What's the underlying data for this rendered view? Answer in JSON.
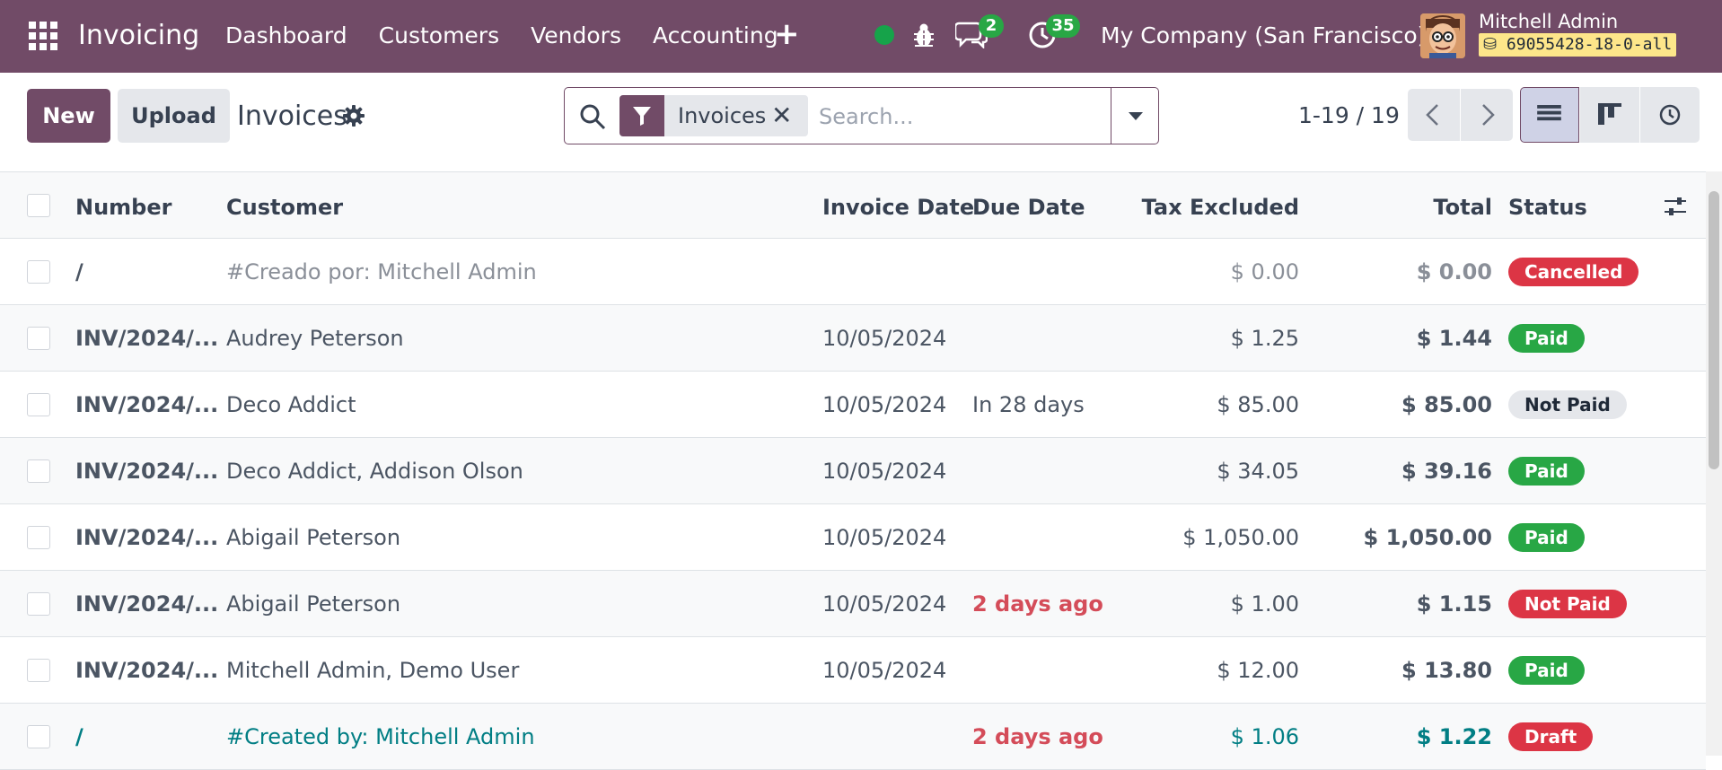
{
  "navbar": {
    "brand": "Invoicing",
    "menu": [
      {
        "label": "Dashboard"
      },
      {
        "label": "Customers"
      },
      {
        "label": "Vendors"
      },
      {
        "label": "Accounting"
      }
    ],
    "messages_count": "2",
    "activities_count": "35",
    "company": "My Company (San Francisco)",
    "user_name": "Mitchell Admin",
    "database": "69055428-18-0-all"
  },
  "control": {
    "new_label": "New",
    "upload_label": "Upload",
    "title": "Invoices",
    "facet_label": "Invoices",
    "facet_close": "✕",
    "search_placeholder": "Search...",
    "pager": "1-19 / 19"
  },
  "columns": {
    "number": "Number",
    "customer": "Customer",
    "invoice_date": "Invoice Date",
    "due_date": "Due Date",
    "tax_excluded": "Tax Excluded",
    "total": "Total",
    "status": "Status"
  },
  "rows": [
    {
      "number": "/",
      "customer": "#Creado por: Mitchell Admin",
      "invoice_date": "",
      "due_date": "",
      "tax_excluded": "$ 0.00",
      "total": "$ 0.00",
      "status": "Cancelled",
      "status_color": "#dc3545"
    },
    {
      "number": "INV/2024/...",
      "customer": "Audrey Peterson",
      "invoice_date": "10/05/2024",
      "due_date": "",
      "tax_excluded": "$ 1.25",
      "total": "$ 1.44",
      "status": "Paid",
      "status_color": "#28a745"
    },
    {
      "number": "INV/2024/...",
      "customer": "Deco Addict",
      "invoice_date": "10/05/2024",
      "due_date": "In 28 days",
      "tax_excluded": "$ 85.00",
      "total": "$ 85.00",
      "status": "Not Paid",
      "status_color": "#e5e7eb"
    },
    {
      "number": "INV/2024/...",
      "customer": "Deco Addict, Addison Olson",
      "invoice_date": "10/05/2024",
      "due_date": "",
      "tax_excluded": "$ 34.05",
      "total": "$ 39.16",
      "status": "Paid",
      "status_color": "#28a745"
    },
    {
      "number": "INV/2024/...",
      "customer": "Abigail Peterson",
      "invoice_date": "10/05/2024",
      "due_date": "",
      "tax_excluded": "$ 1,050.00",
      "total": "$ 1,050.00",
      "status": "Paid",
      "status_color": "#28a745"
    },
    {
      "number": "INV/2024/...",
      "customer": "Abigail Peterson",
      "invoice_date": "10/05/2024",
      "due_date": "2 days ago",
      "tax_excluded": "$ 1.00",
      "total": "$ 1.15",
      "status": "Not Paid",
      "status_color": "#dc3545"
    },
    {
      "number": "INV/2024/...",
      "customer": "Mitchell Admin, Demo User",
      "invoice_date": "10/05/2024",
      "due_date": "",
      "tax_excluded": "$ 12.00",
      "total": "$ 13.80",
      "status": "Paid",
      "status_color": "#28a745"
    },
    {
      "number": "/",
      "customer": "#Created by: Mitchell Admin",
      "invoice_date": "",
      "due_date": "2 days ago",
      "tax_excluded": "$ 1.06",
      "total": "$ 1.22",
      "status": "Draft",
      "status_color": "#dc3545"
    }
  ],
  "colors": {
    "brand": "#714b67",
    "paid": "#28a745",
    "cancelled": "#dc3545",
    "overdue": "#d44c59",
    "draft_text": "#017e84"
  },
  "icons": [
    "apps-grid-icon",
    "plus-icon",
    "status-dot-icon",
    "bug-icon",
    "chat-icon",
    "clock-icon",
    "gear-icon",
    "search-icon",
    "filter-icon",
    "chevron-left-icon",
    "chevron-right-icon",
    "list-view-icon",
    "kanban-view-icon",
    "activity-view-icon",
    "optional-columns-icon"
  ]
}
